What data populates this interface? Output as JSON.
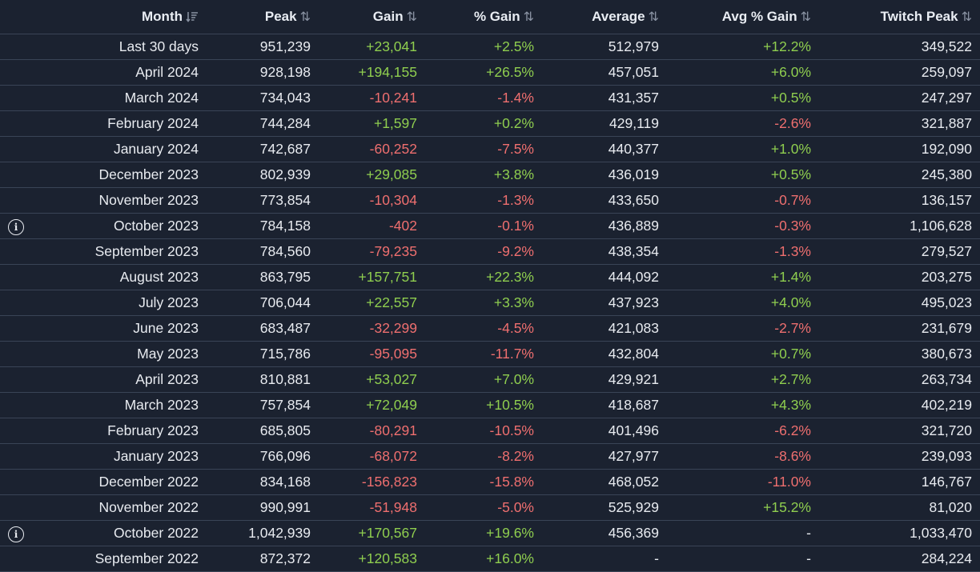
{
  "table": {
    "headers": {
      "month": "Month",
      "peak": "Peak",
      "gain": "Gain",
      "pct_gain": "% Gain",
      "average": "Average",
      "avg_pct_gain": "Avg % Gain",
      "twitch_peak": "Twitch Peak"
    },
    "sort": {
      "active_column": "month",
      "active_icon": "sort-descending-icon",
      "inactive_icon": "sort-arrows-icon"
    },
    "colors": {
      "positive": "#8fce4f",
      "negative": "#ef6f6f",
      "neutral": "#e8ebf0",
      "background": "#1b2230",
      "divider": "#3a4456"
    },
    "info_icon_glyph": "i",
    "rows": [
      {
        "month": "Last 30 days",
        "peak": "951,239",
        "gain": "+23,041",
        "pct_gain": "+2.5%",
        "average": "512,979",
        "avg_pct_gain": "+12.2%",
        "twitch_peak": "349,522",
        "info": false
      },
      {
        "month": "April 2024",
        "peak": "928,198",
        "gain": "+194,155",
        "pct_gain": "+26.5%",
        "average": "457,051",
        "avg_pct_gain": "+6.0%",
        "twitch_peak": "259,097",
        "info": false
      },
      {
        "month": "March 2024",
        "peak": "734,043",
        "gain": "-10,241",
        "pct_gain": "-1.4%",
        "average": "431,357",
        "avg_pct_gain": "+0.5%",
        "twitch_peak": "247,297",
        "info": false
      },
      {
        "month": "February 2024",
        "peak": "744,284",
        "gain": "+1,597",
        "pct_gain": "+0.2%",
        "average": "429,119",
        "avg_pct_gain": "-2.6%",
        "twitch_peak": "321,887",
        "info": false
      },
      {
        "month": "January 2024",
        "peak": "742,687",
        "gain": "-60,252",
        "pct_gain": "-7.5%",
        "average": "440,377",
        "avg_pct_gain": "+1.0%",
        "twitch_peak": "192,090",
        "info": false
      },
      {
        "month": "December 2023",
        "peak": "802,939",
        "gain": "+29,085",
        "pct_gain": "+3.8%",
        "average": "436,019",
        "avg_pct_gain": "+0.5%",
        "twitch_peak": "245,380",
        "info": false
      },
      {
        "month": "November 2023",
        "peak": "773,854",
        "gain": "-10,304",
        "pct_gain": "-1.3%",
        "average": "433,650",
        "avg_pct_gain": "-0.7%",
        "twitch_peak": "136,157",
        "info": false
      },
      {
        "month": "October 2023",
        "peak": "784,158",
        "gain": "-402",
        "pct_gain": "-0.1%",
        "average": "436,889",
        "avg_pct_gain": "-0.3%",
        "twitch_peak": "1,106,628",
        "info": true
      },
      {
        "month": "September 2023",
        "peak": "784,560",
        "gain": "-79,235",
        "pct_gain": "-9.2%",
        "average": "438,354",
        "avg_pct_gain": "-1.3%",
        "twitch_peak": "279,527",
        "info": false
      },
      {
        "month": "August 2023",
        "peak": "863,795",
        "gain": "+157,751",
        "pct_gain": "+22.3%",
        "average": "444,092",
        "avg_pct_gain": "+1.4%",
        "twitch_peak": "203,275",
        "info": false
      },
      {
        "month": "July 2023",
        "peak": "706,044",
        "gain": "+22,557",
        "pct_gain": "+3.3%",
        "average": "437,923",
        "avg_pct_gain": "+4.0%",
        "twitch_peak": "495,023",
        "info": false
      },
      {
        "month": "June 2023",
        "peak": "683,487",
        "gain": "-32,299",
        "pct_gain": "-4.5%",
        "average": "421,083",
        "avg_pct_gain": "-2.7%",
        "twitch_peak": "231,679",
        "info": false
      },
      {
        "month": "May 2023",
        "peak": "715,786",
        "gain": "-95,095",
        "pct_gain": "-11.7%",
        "average": "432,804",
        "avg_pct_gain": "+0.7%",
        "twitch_peak": "380,673",
        "info": false
      },
      {
        "month": "April 2023",
        "peak": "810,881",
        "gain": "+53,027",
        "pct_gain": "+7.0%",
        "average": "429,921",
        "avg_pct_gain": "+2.7%",
        "twitch_peak": "263,734",
        "info": false
      },
      {
        "month": "March 2023",
        "peak": "757,854",
        "gain": "+72,049",
        "pct_gain": "+10.5%",
        "average": "418,687",
        "avg_pct_gain": "+4.3%",
        "twitch_peak": "402,219",
        "info": false
      },
      {
        "month": "February 2023",
        "peak": "685,805",
        "gain": "-80,291",
        "pct_gain": "-10.5%",
        "average": "401,496",
        "avg_pct_gain": "-6.2%",
        "twitch_peak": "321,720",
        "info": false
      },
      {
        "month": "January 2023",
        "peak": "766,096",
        "gain": "-68,072",
        "pct_gain": "-8.2%",
        "average": "427,977",
        "avg_pct_gain": "-8.6%",
        "twitch_peak": "239,093",
        "info": false
      },
      {
        "month": "December 2022",
        "peak": "834,168",
        "gain": "-156,823",
        "pct_gain": "-15.8%",
        "average": "468,052",
        "avg_pct_gain": "-11.0%",
        "twitch_peak": "146,767",
        "info": false
      },
      {
        "month": "November 2022",
        "peak": "990,991",
        "gain": "-51,948",
        "pct_gain": "-5.0%",
        "average": "525,929",
        "avg_pct_gain": "+15.2%",
        "twitch_peak": "81,020",
        "info": false
      },
      {
        "month": "October 2022",
        "peak": "1,042,939",
        "gain": "+170,567",
        "pct_gain": "+19.6%",
        "average": "456,369",
        "avg_pct_gain": "-",
        "twitch_peak": "1,033,470",
        "info": true
      },
      {
        "month": "September 2022",
        "peak": "872,372",
        "gain": "+120,583",
        "pct_gain": "+16.0%",
        "average": "-",
        "avg_pct_gain": "-",
        "twitch_peak": "284,224",
        "info": false
      }
    ]
  }
}
